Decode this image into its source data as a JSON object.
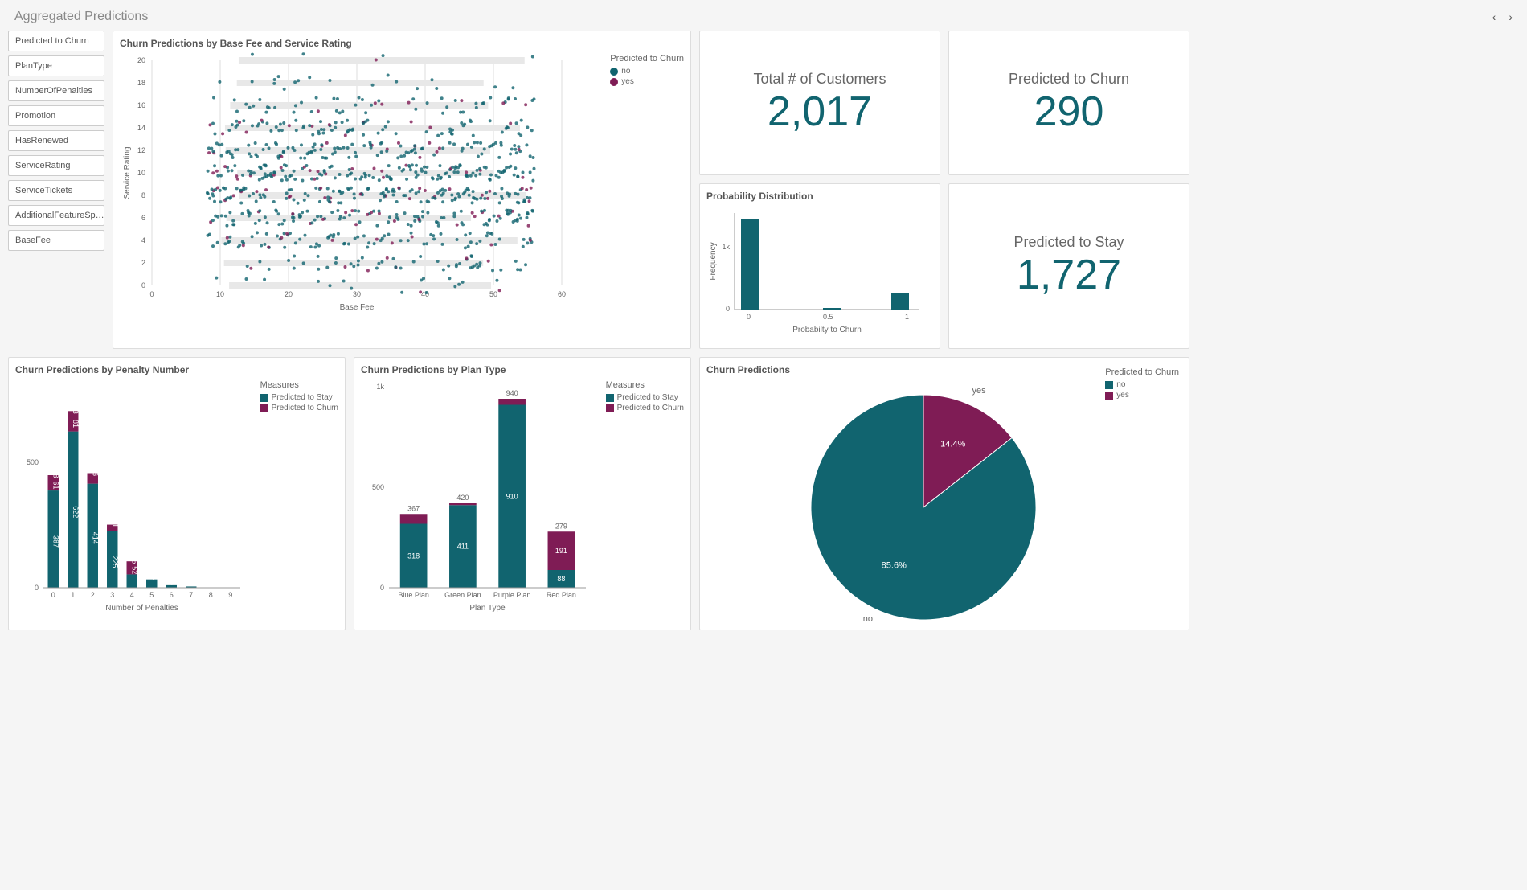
{
  "header": {
    "title": "Aggregated Predictions"
  },
  "sidebar": {
    "filters": [
      "Predicted to Churn",
      "PlanType",
      "NumberOfPenalties",
      "Promotion",
      "HasRenewed",
      "ServiceRating",
      "ServiceTickets",
      "AdditionalFeatureSp…",
      "BaseFee"
    ]
  },
  "scatter": {
    "title": "Churn Predictions by Base Fee and Service Rating",
    "xlabel": "Base Fee",
    "ylabel": "Service Rating",
    "legend_title": "Predicted to Churn",
    "legend": [
      "no",
      "yes"
    ]
  },
  "kpi": {
    "total_customers": {
      "label": "Total # of Customers",
      "value": "2,017"
    },
    "predicted_churn": {
      "label": "Predicted to Churn",
      "value": "290"
    },
    "predicted_stay": {
      "label": "Predicted to Stay",
      "value": "1,727"
    }
  },
  "prob_dist": {
    "title": "Probability Distribution",
    "xlabel": "Probabilty to Churn",
    "ylabel": "Frequency"
  },
  "penalty": {
    "title": "Churn Predictions by Penalty Number",
    "xlabel": "Number of Penalties",
    "legend_title": "Measures",
    "legend": [
      "Predicted to Stay",
      "Predicted to Churn"
    ]
  },
  "plantype": {
    "title": "Churn Predictions by Plan Type",
    "xlabel": "Plan Type",
    "legend_title": "Measures",
    "legend": [
      "Predicted to Stay",
      "Predicted to Churn"
    ]
  },
  "pie": {
    "title": "Churn Predictions",
    "legend_title": "Predicted to Churn",
    "legend": [
      "no",
      "yes"
    ]
  },
  "chart_data": [
    {
      "type": "scatter",
      "title": "Churn Predictions by Base Fee and Service Rating",
      "xlabel": "Base Fee",
      "ylabel": "Service Rating",
      "xlim": [
        0,
        60
      ],
      "ylim": [
        0,
        20
      ],
      "series": [
        {
          "name": "no",
          "color": "#11646f"
        },
        {
          "name": "yes",
          "color": "#7f1c55"
        }
      ],
      "note": "~2017 points across integer ServiceRating bands 0–20; points not individually labeled"
    },
    {
      "type": "bar",
      "title": "Probability Distribution",
      "xlabel": "Probabilty to Churn",
      "ylabel": "Frequency",
      "categories": [
        0,
        0.5,
        1
      ],
      "values": [
        1500,
        20,
        150
      ],
      "ylim": [
        0,
        1600
      ]
    },
    {
      "type": "bar",
      "title": "Churn Predictions by Penalty Number",
      "xlabel": "Number of Penalties",
      "categories": [
        0,
        1,
        2,
        3,
        4,
        5,
        6,
        7,
        8,
        9
      ],
      "series": [
        {
          "name": "Predicted to Stay",
          "values": [
            387,
            622,
            414,
            225,
            53,
            33,
            10,
            5,
            1,
            1
          ],
          "color": "#11646f"
        },
        {
          "name": "Predicted to Churn",
          "values": [
            61,
            81,
            42,
            26,
            52,
            1,
            1,
            0,
            0,
            0
          ],
          "color": "#7f1c55"
        }
      ],
      "totals": [
        448,
        703,
        456,
        251,
        105,
        34,
        11,
        5,
        1,
        1
      ],
      "ylim": [
        0,
        800
      ]
    },
    {
      "type": "bar",
      "title": "Churn Predictions by Plan Type",
      "xlabel": "Plan Type",
      "categories": [
        "Blue Plan",
        "Green Plan",
        "Purple Plan",
        "Red Plan"
      ],
      "series": [
        {
          "name": "Predicted to Stay",
          "values": [
            318,
            411,
            910,
            88
          ],
          "color": "#11646f"
        },
        {
          "name": "Predicted to Churn",
          "values": [
            49,
            9,
            30,
            191
          ],
          "color": "#7f1c55"
        }
      ],
      "totals": [
        367,
        420,
        940,
        279
      ],
      "ylim": [
        0,
        1000
      ]
    },
    {
      "type": "pie",
      "title": "Churn Predictions",
      "slices": [
        {
          "name": "no",
          "pct": 85.6,
          "color": "#11646f"
        },
        {
          "name": "yes",
          "pct": 14.4,
          "color": "#7f1c55"
        }
      ]
    }
  ]
}
